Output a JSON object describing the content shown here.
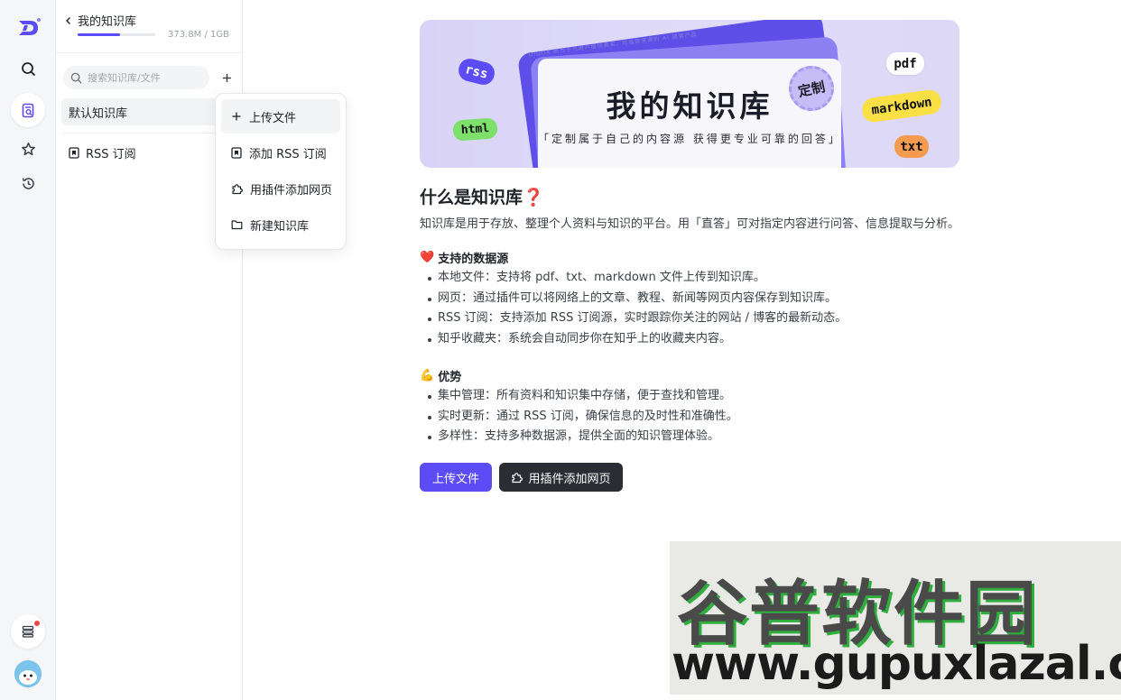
{
  "sidebar": {
    "logo": "D"
  },
  "panel": {
    "back_title": "我的知识库",
    "usage": {
      "text": "373.8M / 1GB",
      "fraction": 0.55
    },
    "search": {
      "placeholder": "搜索知识库/文件",
      "value": ""
    },
    "knowledge_items": [
      "默认知识库"
    ],
    "rss_label": "RSS 订阅"
  },
  "menu": {
    "items": [
      "上传文件",
      "添加 RSS 订阅",
      "用插件添加网页",
      "新建知识库"
    ]
  },
  "banner": {
    "title": "我的知识库",
    "subtitle": "「定制属于自己的内容源 获得更专业可靠的回答」",
    "micro": "DIGUA 助力于为用户提供真实、可追踪来源的 AI 搜索产品",
    "seal": "定制",
    "tags": [
      "rss",
      "html",
      "pdf",
      "markdown",
      "txt"
    ]
  },
  "content": {
    "heading": "什么是知识库",
    "heading_emoji": "❓",
    "lead": "知识库是用于存放、整理个人资料与知识的平台。用「直答」可对指定内容进行问答、信息提取与分析。",
    "sections": [
      {
        "emoji": "❤️",
        "title": "支持的数据源",
        "items": [
          "本地文件：支持将 pdf、txt、markdown 文件上传到知识库。",
          "网页：通过插件可以将网络上的文章、教程、新闻等网页内容保存到知识库。",
          "RSS 订阅：支持添加 RSS 订阅源，实时跟踪你关注的网站 / 博客的最新动态。",
          "知乎收藏夹：系统会自动同步你在知乎上的收藏夹内容。"
        ]
      },
      {
        "emoji": "💪",
        "title": "优势",
        "items": [
          "集中管理：所有资料和知识集中存储，便于查找和管理。",
          "实时更新：通过 RSS 订阅，确保信息的及时性和准确性。",
          "多样性：支持多种数据源，提供全面的知识管理体验。"
        ]
      }
    ],
    "buttons": {
      "upload": "上传文件",
      "plugin": "用插件添加网页"
    }
  },
  "watermark": {
    "cn": "谷普软件园",
    "url": "www.gupuxlazal.com"
  },
  "colors": {
    "accent": "#5b4cf5",
    "dark_button": "#2a2d33",
    "notification": "#f04848"
  }
}
